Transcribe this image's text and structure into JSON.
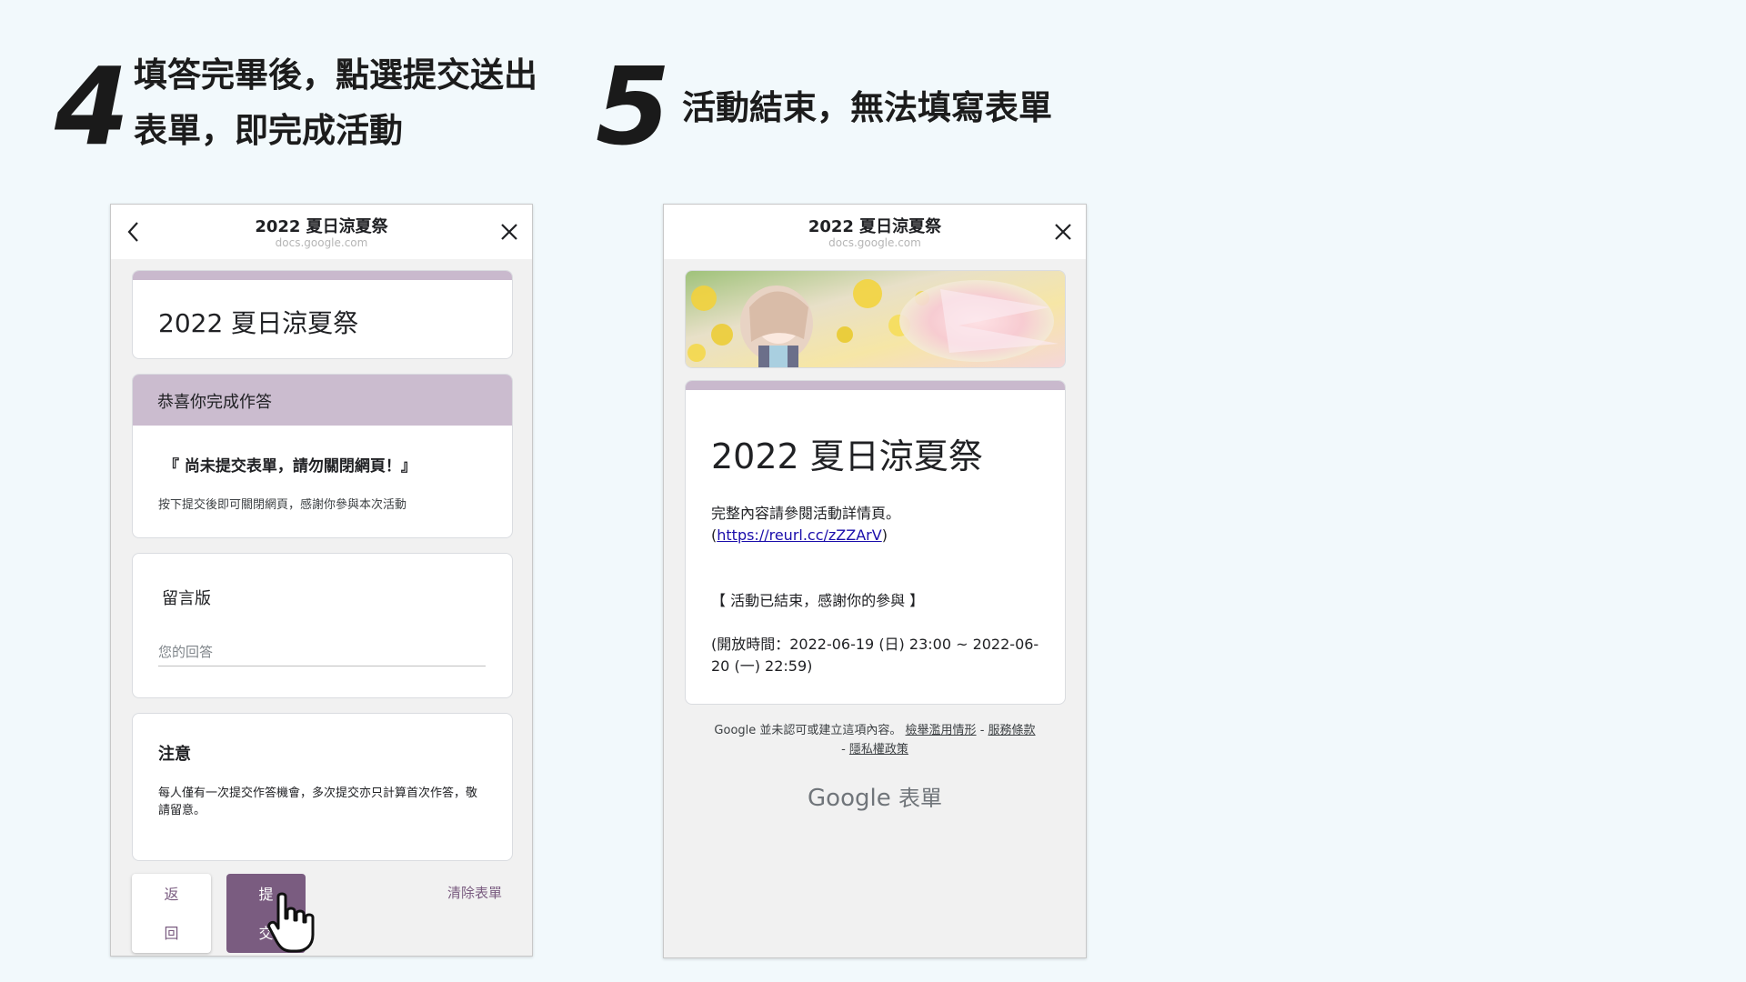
{
  "steps": {
    "step4": {
      "number": "4",
      "line1": "填答完畢後，點選提交送出",
      "line2": "表單，即完成活動"
    },
    "step5": {
      "number": "5",
      "text": "活動結束，無法填寫表單"
    }
  },
  "left_phone": {
    "header_title": "2022 夏日涼夏祭",
    "header_url": "docs.google.com",
    "form_title": "2022 夏日涼夏祭",
    "section_heading": "恭喜你完成作答",
    "section_notice": "『 尚未提交表單，請勿關閉網頁！』",
    "section_note": "按下提交後即可關閉網頁，感謝你參與本次活動",
    "comment_label": "留言版",
    "comment_placeholder": "您的回答",
    "note_title": "注意",
    "note_body": "每人僅有一次提交作答機會，多次提交亦只計算首次作答，敬請留意。",
    "btn_back_line1": "返",
    "btn_back_line2": "回",
    "btn_submit_line1": "提",
    "btn_submit_line2": "交",
    "btn_clear": "清除表單"
  },
  "right_phone": {
    "header_title": "2022 夏日涼夏祭",
    "header_url": "docs.google.com",
    "form_title": "2022 夏日涼夏祭",
    "detail_text": "完整內容請參閱活動詳情頁。",
    "link_open": "(",
    "link_text": "https://reurl.cc/zZZArV",
    "link_close": ")",
    "ended_text": "【 活動已結束，感謝你的參與 】",
    "open_time_line1": "(開放時間：2022-06-19 (日) 23:00 ~ 2022-06-",
    "open_time_line2": "20 (一) 22:59)",
    "footer_text": "Google 並未認可或建立這項內容。",
    "footer_link_abuse": "檢舉濫用情形",
    "footer_link_terms": "服務條款",
    "footer_link_privacy": "隱私權政策",
    "footer_sep": "-",
    "brand_google": "Google",
    "brand_forms": "表單"
  },
  "colors": {
    "accent": "#7a5c80",
    "section_header": "#cbbccf",
    "background": "#f2f9fc"
  }
}
